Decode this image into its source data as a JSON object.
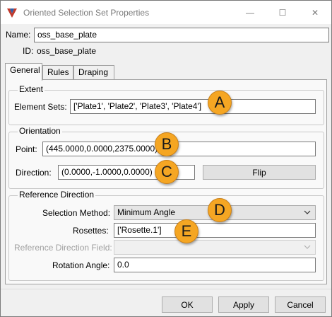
{
  "window": {
    "title": "Oriented Selection Set Properties",
    "controls": {
      "minimize": "—",
      "maximize": "☐",
      "close": "✕"
    }
  },
  "name": {
    "label": "Name:",
    "value": "oss_base_plate"
  },
  "id": {
    "label": "ID:",
    "value": "oss_base_plate"
  },
  "tabs": [
    {
      "label": "General",
      "active": true
    },
    {
      "label": "Rules",
      "active": false
    },
    {
      "label": "Draping",
      "active": false
    }
  ],
  "extent": {
    "title": "Extent",
    "element_sets_label": "Element Sets:",
    "element_sets_value": "['Plate1', 'Plate2', 'Plate3', 'Plate4']"
  },
  "orientation": {
    "title": "Orientation",
    "point_label": "Point:",
    "point_value": "(445.0000,0.0000,2375.0000)",
    "direction_label": "Direction:",
    "direction_value": "(0.0000,-1.0000,0.0000)",
    "flip_label": "Flip"
  },
  "reference_direction": {
    "title": "Reference Direction",
    "selection_method_label": "Selection Method:",
    "selection_method_value": "Minimum Angle",
    "rosettes_label": "Rosettes:",
    "rosettes_value": "['Rosette.1']",
    "ref_field_label": "Reference Direction Field:",
    "ref_field_value": "",
    "rotation_angle_label": "Rotation Angle:",
    "rotation_angle_value": "0.0"
  },
  "callouts": [
    "A",
    "B",
    "C",
    "D",
    "E"
  ],
  "footer": {
    "ok": "OK",
    "apply": "Apply",
    "cancel": "Cancel"
  },
  "colors": {
    "callout": "#f5a623",
    "title_text": "#7a7a7a",
    "panel": "#f9f9f9",
    "chrome": "#f0f0f0"
  }
}
